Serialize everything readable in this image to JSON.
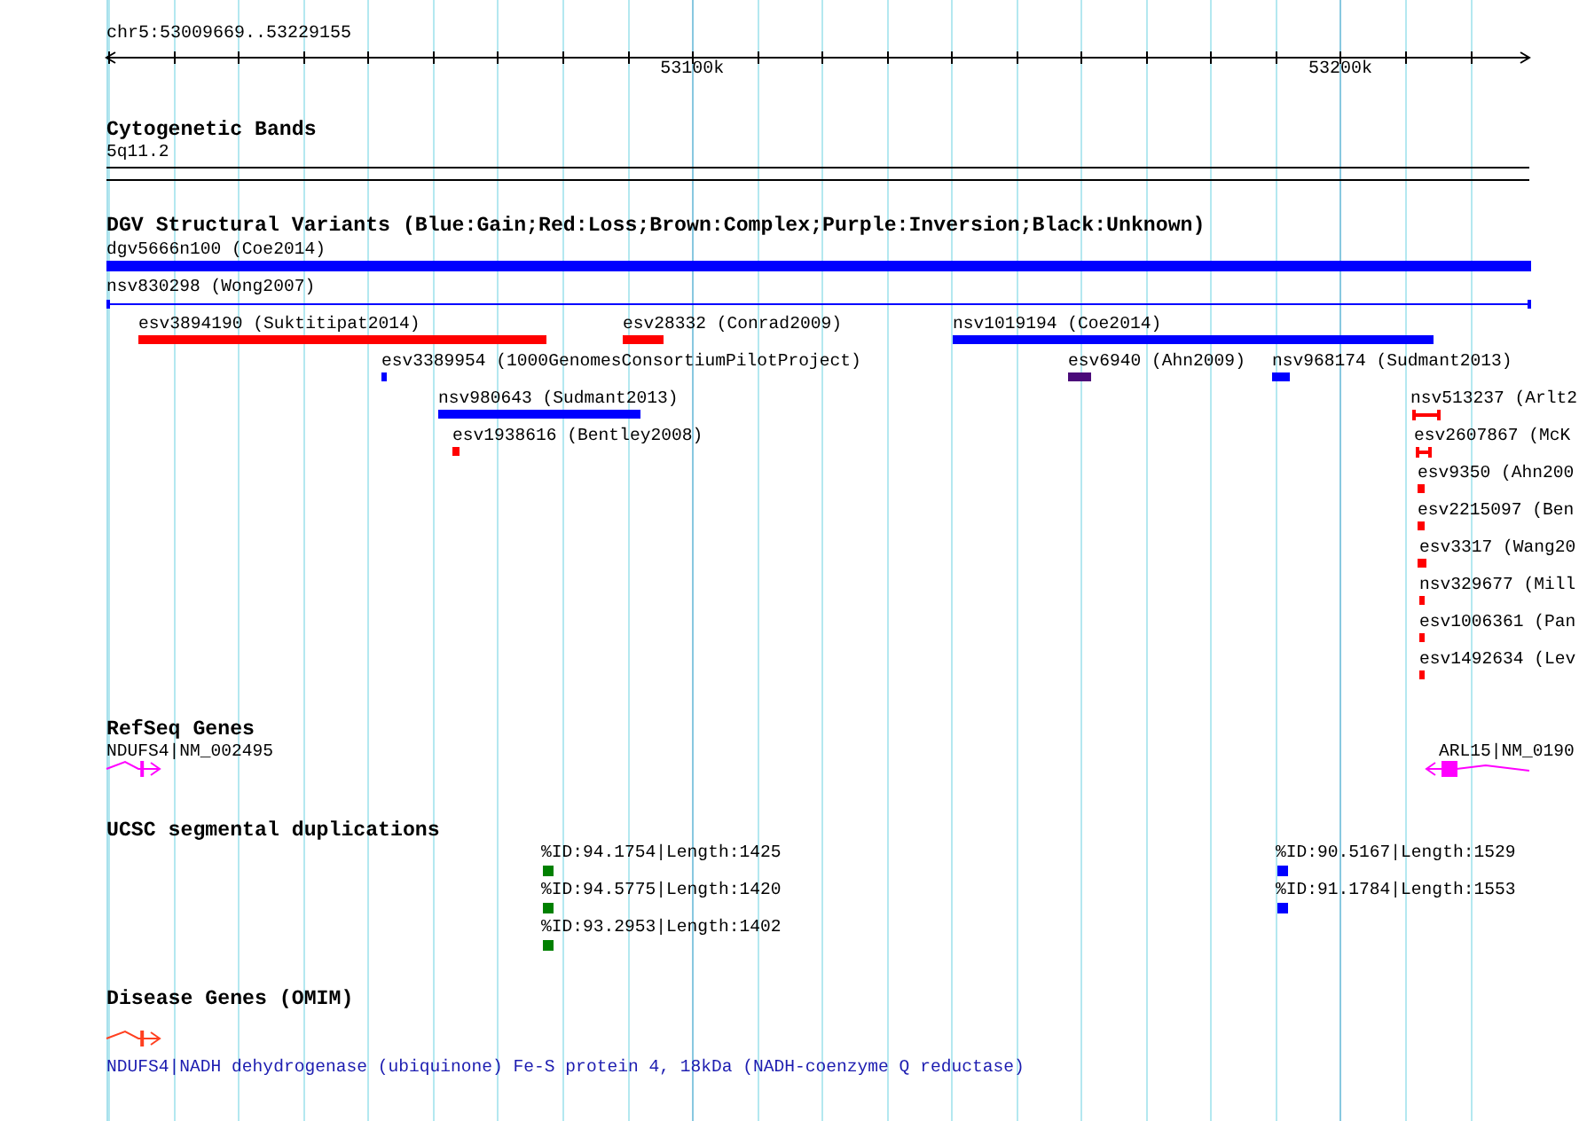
{
  "ruler": {
    "position": "chr5:53009669..53229155",
    "ticks": [
      "53100k",
      "53200k"
    ]
  },
  "tracks": [
    {
      "kind": "bands",
      "title": "Cytogenetic Bands",
      "items": [
        {
          "label": "5q11.2"
        }
      ]
    },
    {
      "kind": "variants",
      "title": "DGV Structural Variants (Blue:Gain;Red:Loss;Brown:Complex;Purple:Inversion;Black:Unknown)",
      "items": [
        {
          "label": "dgv5666n100 (Coe2014)",
          "kind": "bar",
          "color": "#0000ff"
        },
        {
          "label": "nsv830298 (Wong2007)",
          "kind": "span",
          "color": "#0000ff"
        },
        {
          "label": "esv3894190 (Suktitipat2014)",
          "kind": "bar",
          "color": "#ff0000"
        },
        {
          "label": "esv28332 (Conrad2009)",
          "kind": "bar",
          "color": "#ff0000"
        },
        {
          "label": "nsv1019194 (Coe2014)",
          "kind": "bar",
          "color": "#0000ff"
        },
        {
          "label": "esv3389954 (1000GenomesConsortiumPilotProject)",
          "kind": "bar",
          "color": "#0000ff"
        },
        {
          "label": "esv6940 (Ahn2009)",
          "kind": "bar",
          "color": "#4b0b7a"
        },
        {
          "label": "nsv968174 (Sudmant2013)",
          "kind": "bar",
          "color": "#0000ff"
        },
        {
          "label": "nsv980643 (Sudmant2013)",
          "kind": "bar",
          "color": "#0000ff"
        },
        {
          "label": "nsv513237 (Arlt2",
          "kind": "span",
          "color": "#ff0000"
        },
        {
          "label": "esv1938616 (Bentley2008)",
          "kind": "bar",
          "color": "#ff0000"
        },
        {
          "label": "esv2607867 (McK",
          "kind": "span",
          "color": "#ff0000"
        },
        {
          "label": "esv9350 (Ahn200",
          "kind": "bar",
          "color": "#ff0000"
        },
        {
          "label": "esv2215097 (Ben",
          "kind": "bar",
          "color": "#ff0000"
        },
        {
          "label": "esv3317 (Wang20",
          "kind": "bar",
          "color": "#ff0000"
        },
        {
          "label": "nsv329677 (Mill",
          "kind": "bar",
          "color": "#ff0000"
        },
        {
          "label": "esv1006361 (Pan",
          "kind": "bar",
          "color": "#ff0000"
        },
        {
          "label": "esv1492634 (Lev",
          "kind": "bar",
          "color": "#ff0000"
        }
      ]
    },
    {
      "kind": "genes",
      "title": "RefSeq Genes",
      "items": [
        {
          "label": "NDUFS4|NM_002495",
          "kind": "forward"
        },
        {
          "label": "ARL15|NM_0190",
          "kind": "reverse"
        }
      ]
    },
    {
      "kind": "segdups",
      "title": "UCSC segmental duplications",
      "items": [
        {
          "label": "%ID:94.1754|Length:1425",
          "color": "#008000"
        },
        {
          "label": "%ID:90.5167|Length:1529",
          "color": "#0000ff"
        },
        {
          "label": "%ID:94.5775|Length:1420",
          "color": "#008000"
        },
        {
          "label": "%ID:91.1784|Length:1553",
          "color": "#0000ff"
        },
        {
          "label": "%ID:93.2953|Length:1402",
          "color": "#008000"
        }
      ]
    },
    {
      "kind": "disease",
      "title": "Disease Genes (OMIM)",
      "items": [
        {
          "label": "NDUFS4|NADH dehydrogenase (ubiquinone) Fe-S protein 4, 18kDa (NADH-coenzyme Q reductase)",
          "kind": "forward"
        }
      ]
    }
  ]
}
